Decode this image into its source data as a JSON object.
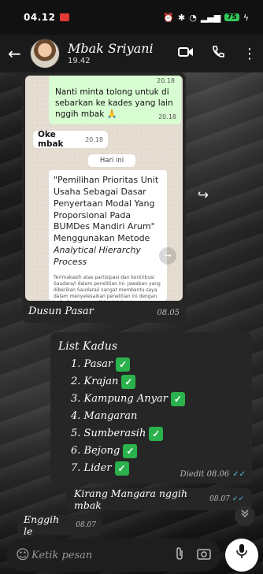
{
  "status_bar": {
    "time": "04.12",
    "battery": "75"
  },
  "header": {
    "contact_name": "Mbak Sriyani",
    "subtitle": "19.42"
  },
  "forwarded_screenshot": {
    "green_message": "Nanti minta tolong untuk di sebarkan ke kades yang lain nggih mbak 🙏",
    "green_time_top": "20.18",
    "green_time": "20.18",
    "white_message": "Oke mbak",
    "white_time": "20.18",
    "date_pill": "Hari ini",
    "doc_title": "\"Pemilihan Prioritas Unit Usaha Sebagai Dasar Penyertaan Modal Yang Proporsional Pada BUMDes Mandiri Arum\" Menggunakan Metode",
    "doc_title_italic": "Analytical Hierarchy Process",
    "doc_body": "Terimakasih atas partisipasi dan kontribusi Saudara/i dalam penelitian ini. Jawaban yang diberikan Saudara/i sangat membantu saya dalam menyelesaikan penelitian ini dengan baik. Semoga penelitian ini dapat memberikan manfaat dan kontribusi positif bagi BUMDes",
    "caption": "Dusun Pasar",
    "caption_time": "08.05"
  },
  "list_message": {
    "title": "List Kadus",
    "items": [
      {
        "text": "1. Pasar",
        "checked": true
      },
      {
        "text": "2. Krajan",
        "checked": true
      },
      {
        "text": "3. Kampung Anyar",
        "checked": true
      },
      {
        "text": "4. Mangaran",
        "checked": false
      },
      {
        "text": "5. Sumberasih",
        "checked": true
      },
      {
        "text": "6. Bejong",
        "checked": true
      },
      {
        "text": "7. Lider",
        "checked": true
      }
    ],
    "meta": "Diedit 08.06"
  },
  "reply_message": {
    "text": "Kirang Mangara nggih mbak",
    "time": "08.07"
  },
  "last_message": {
    "text": "Enggih le",
    "time": "08.07"
  },
  "composer": {
    "placeholder": "Ketik pesan"
  }
}
